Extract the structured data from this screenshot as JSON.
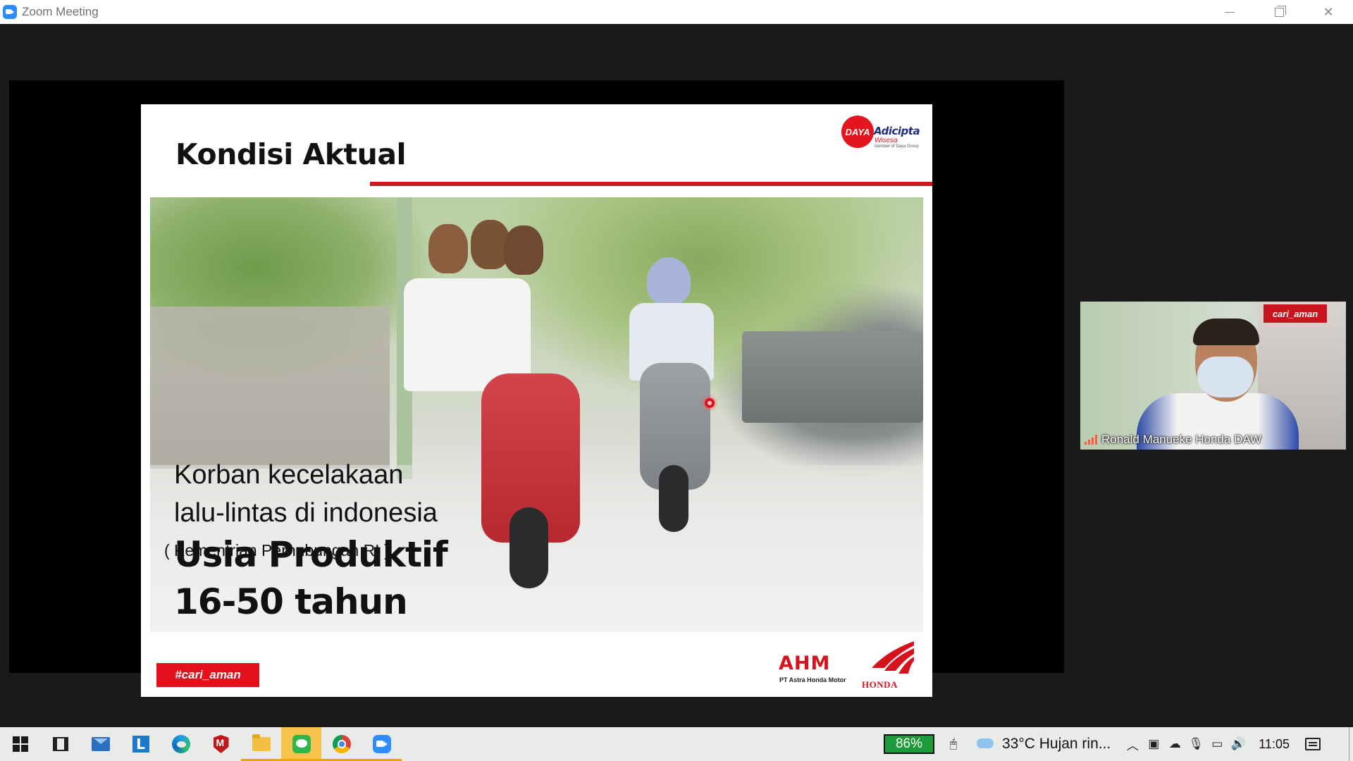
{
  "window": {
    "title": "Zoom Meeting",
    "controls": {
      "minimize": "",
      "restore": "",
      "close": "✕"
    }
  },
  "slide": {
    "title": "Kondisi Aktual",
    "logo_daya": {
      "circle_text": "DAYA",
      "word": "Adicipta",
      "sub": "Wisesa",
      "tiny": "member of Daya Group"
    },
    "caption_line1": "Korban kecelakaan",
    "caption_line2": "lalu-lintas di indonesia",
    "caption_bold1": "Usia Produktif",
    "caption_bold2": "16-50 tahun",
    "caption_source": "( Kementrian Perhubungan RI )",
    "hashtag_badge": "#cari_aman",
    "logo_ahm": {
      "text": "AHM",
      "sub": "PT Astra Honda Motor",
      "honda": "HONDA"
    },
    "accent_color": "#d6121c"
  },
  "participant": {
    "name": "Ronald Manueke Honda DAW",
    "poster_tag": "cari_aman"
  },
  "taskbar": {
    "apps": [
      {
        "name": "start",
        "icon": "windows-start-icon"
      },
      {
        "name": "task-view",
        "icon": "task-view-icon"
      },
      {
        "name": "mail",
        "icon": "mail-icon"
      },
      {
        "name": "l-app",
        "icon": "l-app-icon",
        "label": "L"
      },
      {
        "name": "edge",
        "icon": "edge-icon"
      },
      {
        "name": "mcafee",
        "icon": "mcafee-icon"
      },
      {
        "name": "file-explorer",
        "icon": "folder-icon"
      },
      {
        "name": "line",
        "icon": "line-icon"
      },
      {
        "name": "chrome",
        "icon": "chrome-icon"
      },
      {
        "name": "zoom",
        "icon": "zoom-icon"
      }
    ],
    "battery": "86%",
    "weather": "33°C  Hujan rin...",
    "clock": "11:05"
  }
}
